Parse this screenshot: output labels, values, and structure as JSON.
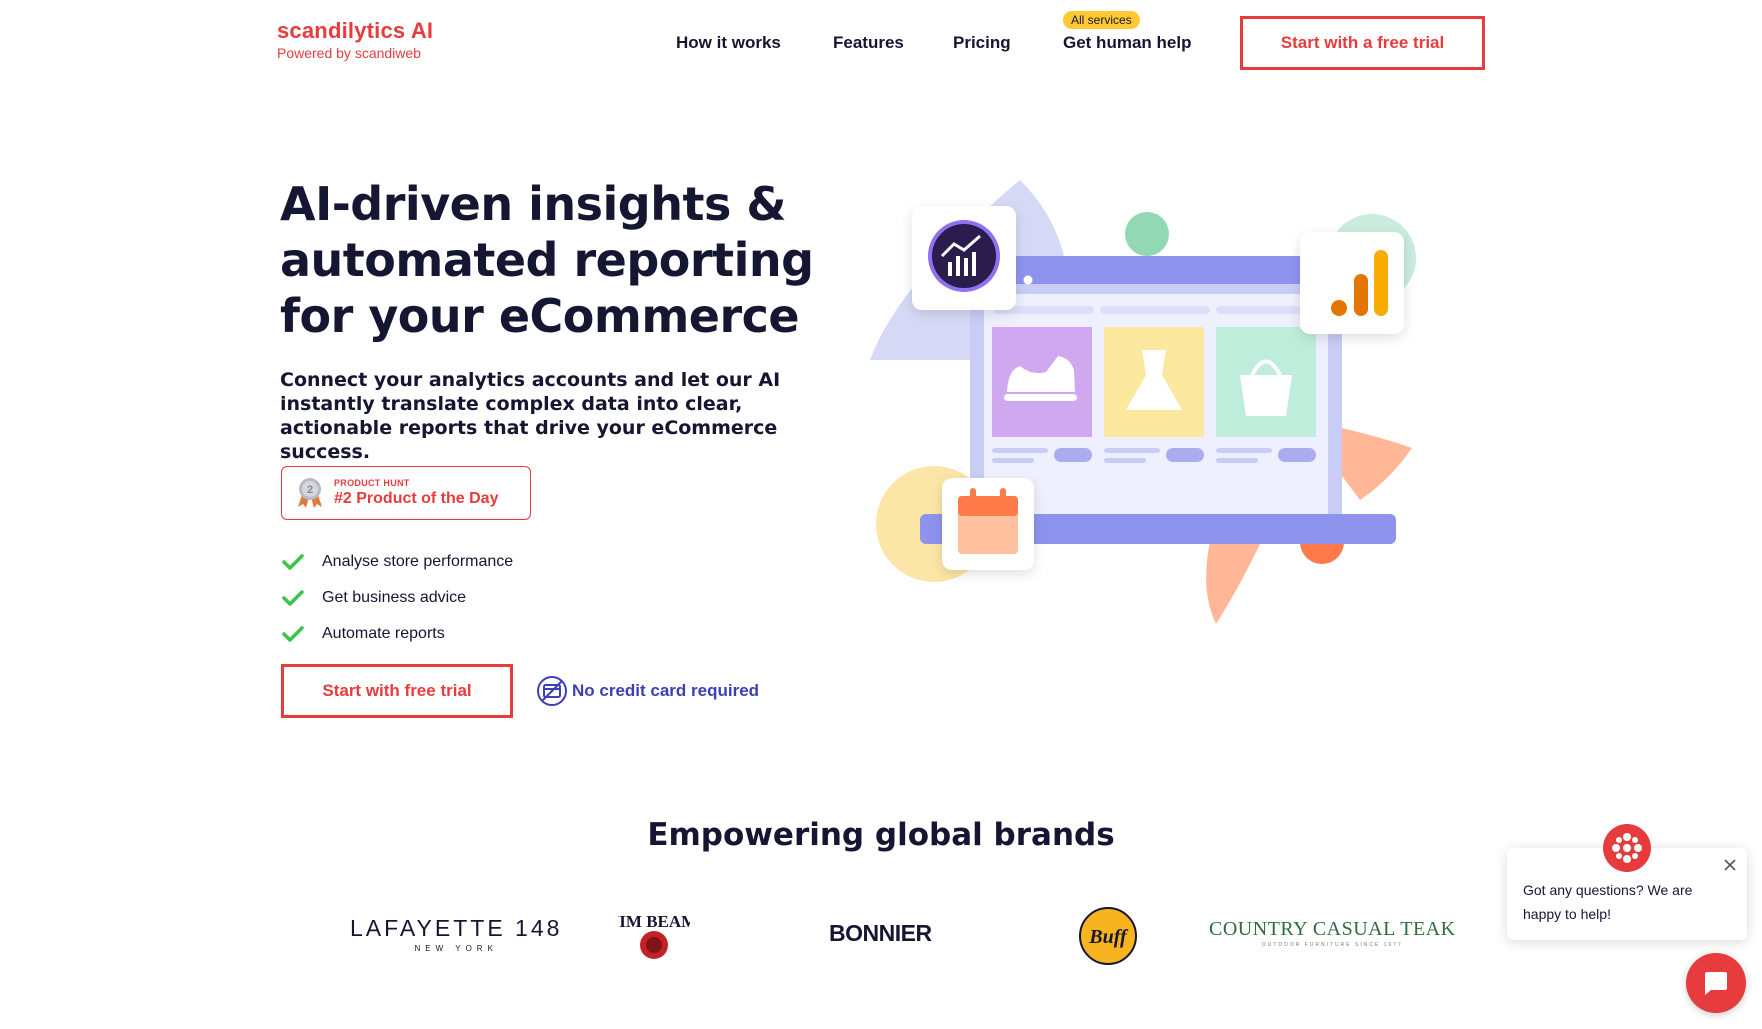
{
  "brand": {
    "name": "scandilytics AI",
    "tagline": "Powered by scandiweb",
    "accent": "#e73c3e"
  },
  "nav": {
    "items": [
      {
        "label": "How it works"
      },
      {
        "label": "Features"
      },
      {
        "label": "Pricing"
      },
      {
        "label": "Get human help",
        "badge": "All services"
      }
    ],
    "cta": "Start with a free trial"
  },
  "hero": {
    "title": "AI-driven insights & automated reporting for your eCommerce",
    "subtitle": "Connect your analytics accounts and let our AI instantly translate complex data into clear, actionable reports that drive your eCommerce success.",
    "badge": {
      "small": "PRODUCT HUNT",
      "big": "#2 Product of the Day",
      "medal": "2"
    },
    "features": [
      "Analyse store performance",
      "Get business advice",
      "Automate reports"
    ],
    "cta": "Start with free trial",
    "note": "No credit card required"
  },
  "brands": {
    "title": "Empowering global brands",
    "logos": {
      "lafayette": "LAFAYETTE 148",
      "lafayette_sub": "NEW YORK",
      "jimbeam": "JIM BEAM",
      "bonnier": "BONNIER",
      "buff": "Buff",
      "cct": "COUNTRY CASUAL TEAK",
      "cct_sub": "OUTDOOR FURNITURE SINCE 1977"
    }
  },
  "chat": {
    "message": "Got any questions? We are happy to help!"
  },
  "icons": {
    "check": "check-icon",
    "no_card": "no-credit-card-icon",
    "medal": "medal-icon",
    "close": "close-icon",
    "chat": "chat-icon"
  }
}
